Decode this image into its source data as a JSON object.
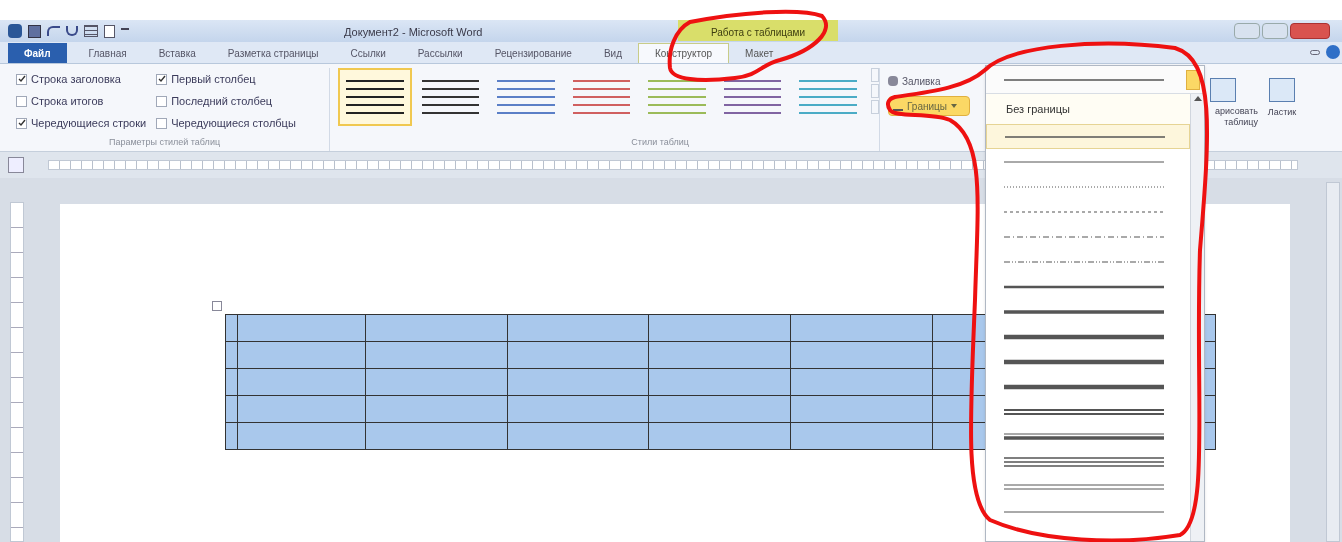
{
  "window": {
    "title": "Документ2 - Microsoft Word"
  },
  "context_tab_header": "Работа с таблицами",
  "tabs": [
    {
      "label": "Файл",
      "kind": "file",
      "selected": false
    },
    {
      "label": "Главная",
      "kind": "normal",
      "selected": false
    },
    {
      "label": "Вставка",
      "kind": "normal",
      "selected": false
    },
    {
      "label": "Разметка страницы",
      "kind": "normal",
      "selected": false
    },
    {
      "label": "Ссылки",
      "kind": "normal",
      "selected": false
    },
    {
      "label": "Рассылки",
      "kind": "normal",
      "selected": false
    },
    {
      "label": "Рецензирование",
      "kind": "normal",
      "selected": false
    },
    {
      "label": "Вид",
      "kind": "normal",
      "selected": false
    },
    {
      "label": "Конструктор",
      "kind": "context",
      "selected": true
    },
    {
      "label": "Макет",
      "kind": "context",
      "selected": false
    }
  ],
  "style_options": {
    "label": "Параметры стилей таблиц",
    "options": [
      {
        "label": "Строка заголовка",
        "checked": true
      },
      {
        "label": "Строка итогов",
        "checked": false
      },
      {
        "label": "Чередующиеся строки",
        "checked": true
      },
      {
        "label": "Первый столбец",
        "checked": true
      },
      {
        "label": "Последний столбец",
        "checked": false
      },
      {
        "label": "Чередующиеся столбцы",
        "checked": false
      }
    ]
  },
  "table_styles": {
    "label": "Стили таблиц",
    "styles": [
      {
        "color": "#222222",
        "selected": true
      },
      {
        "color": "#333333",
        "selected": false
      },
      {
        "color": "#5b7fc7",
        "selected": false
      },
      {
        "color": "#d06060",
        "selected": false
      },
      {
        "color": "#9bbb59",
        "selected": false
      },
      {
        "color": "#8064a2",
        "selected": false
      },
      {
        "color": "#4bacc6",
        "selected": false
      }
    ]
  },
  "shading_button": "Заливка",
  "borders_button": {
    "label": "Границы",
    "selected": true
  },
  "draw_table_button": "арисовать таблицу",
  "eraser_button": "Ластик",
  "line_style_dropdown": {
    "no_border": "Без границы",
    "items": [
      {
        "kind": "solid",
        "selected": true
      },
      {
        "kind": "hairline",
        "selected": false
      },
      {
        "kind": "dotted",
        "selected": false
      },
      {
        "kind": "dashed",
        "selected": false
      },
      {
        "kind": "dash-dot",
        "selected": false
      },
      {
        "kind": "dash-dot-dot",
        "selected": false
      },
      {
        "kind": "medium",
        "selected": false
      },
      {
        "kind": "heavy",
        "selected": false
      },
      {
        "kind": "thick",
        "selected": false
      },
      {
        "kind": "thick",
        "selected": false
      },
      {
        "kind": "thick",
        "selected": false
      },
      {
        "kind": "double",
        "selected": false
      },
      {
        "kind": "thin-thick",
        "selected": false
      },
      {
        "kind": "triple",
        "selected": false
      },
      {
        "kind": "double-thin",
        "selected": false
      },
      {
        "kind": "hairline",
        "selected": false
      }
    ]
  },
  "table": {
    "rows": [
      {
        "cells": [
          {
            "selected": true
          },
          {
            "selected": true
          },
          {
            "selected": true
          },
          {
            "selected": true
          },
          {
            "selected": true
          },
          {
            "selected": true
          },
          {
            "selected": true
          },
          {
            "selected": true
          }
        ]
      },
      {
        "cells": [
          {
            "selected": true
          },
          {
            "selected": true
          },
          {
            "selected": true
          },
          {
            "selected": true
          },
          {
            "selected": true
          },
          {
            "selected": true
          },
          {
            "selected": true
          },
          {
            "selected": true
          }
        ]
      },
      {
        "cells": [
          {
            "selected": true
          },
          {
            "selected": true
          },
          {
            "selected": true
          },
          {
            "selected": true
          },
          {
            "selected": true
          },
          {
            "selected": true
          },
          {
            "selected": true
          },
          {
            "selected": true
          }
        ]
      },
      {
        "cells": [
          {
            "selected": true
          },
          {
            "selected": true
          },
          {
            "selected": true
          },
          {
            "selected": true
          },
          {
            "selected": true
          },
          {
            "selected": true
          },
          {
            "selected": true
          },
          {
            "selected": true
          }
        ]
      },
      {
        "cells": [
          {
            "selected": true
          },
          {
            "selected": true
          },
          {
            "selected": true
          },
          {
            "selected": true
          },
          {
            "selected": true
          },
          {
            "selected": true
          },
          {
            "selected": true
          },
          {
            "selected": true
          }
        ]
      }
    ]
  }
}
